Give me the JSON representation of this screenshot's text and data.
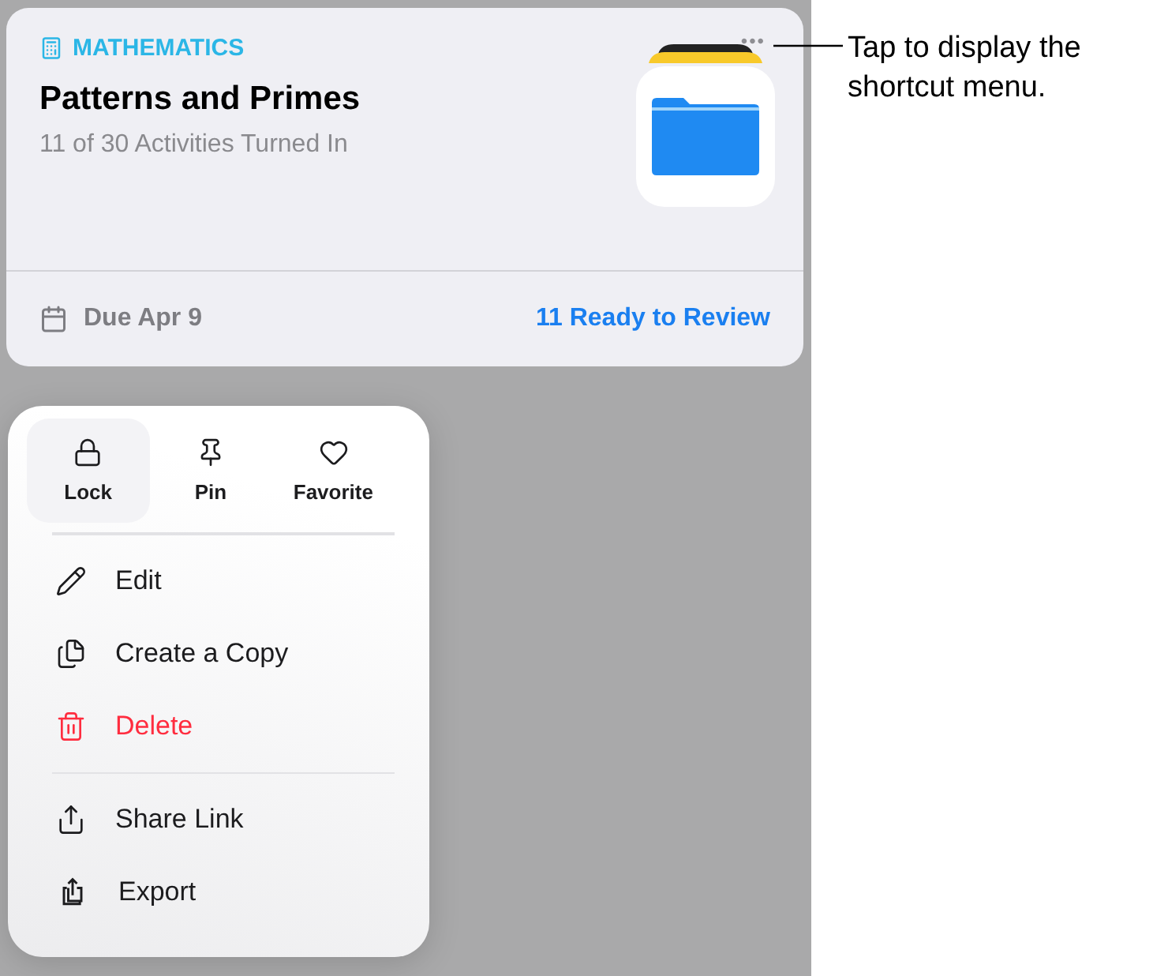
{
  "card": {
    "subject": "MATHEMATICS",
    "title": "Patterns and Primes",
    "subtitle": "11 of 30 Activities Turned In",
    "due": "Due Apr 9",
    "review_link": "11 Ready to Review",
    "more": "•••"
  },
  "menu": {
    "quick_actions": [
      {
        "label": "Lock",
        "kind": "lock",
        "highlighted": true
      },
      {
        "label": "Pin",
        "kind": "pin",
        "highlighted": false
      },
      {
        "label": "Favorite",
        "kind": "heart",
        "highlighted": false
      }
    ],
    "groups": [
      [
        {
          "label": "Edit",
          "kind": "pencil",
          "destructive": false
        },
        {
          "label": "Create a Copy",
          "kind": "copy",
          "destructive": false
        },
        {
          "label": "Delete",
          "kind": "trash",
          "destructive": true
        }
      ],
      [
        {
          "label": "Share Link",
          "kind": "share",
          "destructive": false
        },
        {
          "label": "Export",
          "kind": "export",
          "destructive": false
        }
      ]
    ]
  },
  "callout": "Tap to display the shortcut menu."
}
